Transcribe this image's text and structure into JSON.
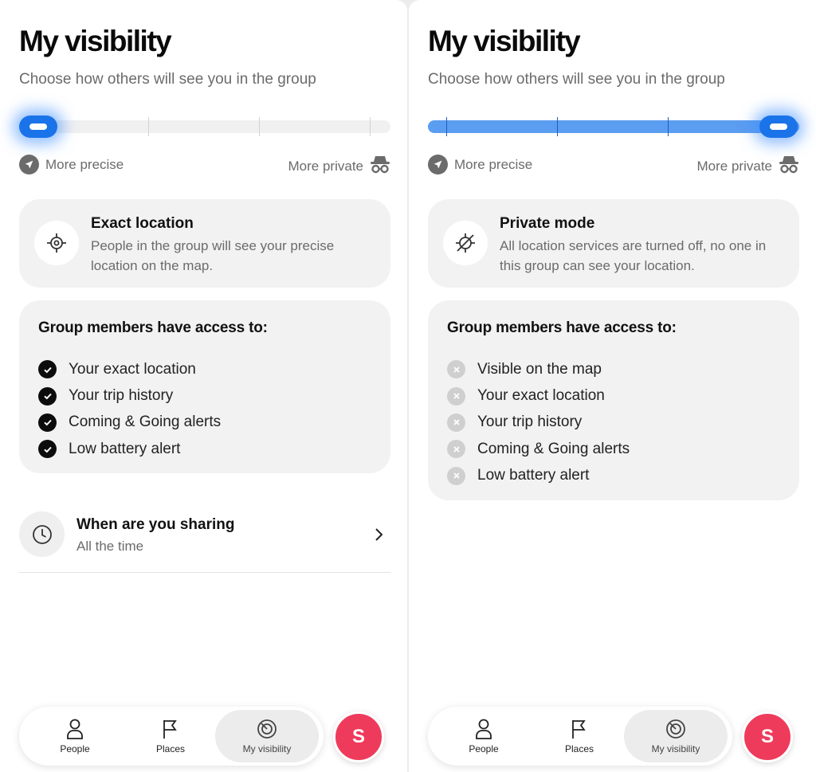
{
  "colors": {
    "accent": "#1a73e8",
    "track_fill": "#5b9df0",
    "avatar": "#ef3b5b",
    "check": "#0c0c0c",
    "cross": "#cfcfcf"
  },
  "screens": [
    {
      "title": "My visibility",
      "subtitle": "Choose how others will see you in the group",
      "slider": {
        "level": 0,
        "stops": 4
      },
      "scale": {
        "left_label": "More precise",
        "right_label": "More private",
        "left_icon": "navigation-arrow-icon",
        "right_icon": "incognito-icon"
      },
      "mode": {
        "icon": "crosshair-icon",
        "title": "Exact location",
        "description": "People in the group will see your precise location on the map."
      },
      "access": {
        "title": "Group members have access to:",
        "state": "enabled",
        "items": [
          {
            "label": "Your exact location"
          },
          {
            "label": "Your trip history"
          },
          {
            "label": "Coming & Going alerts"
          },
          {
            "label": "Low battery alert"
          }
        ]
      },
      "sharing": {
        "icon": "clock-icon",
        "title": "When are you sharing",
        "value": "All the time"
      },
      "tabs": [
        {
          "label": "People",
          "icon": "person-icon",
          "active": false
        },
        {
          "label": "Places",
          "icon": "flag-icon",
          "active": false
        },
        {
          "label": "My visibility",
          "icon": "visibility-icon",
          "active": true
        }
      ],
      "avatar_initial": "S"
    },
    {
      "title": "My visibility",
      "subtitle": "Choose how others will see you in the group",
      "slider": {
        "level": 1,
        "stops": 4
      },
      "scale": {
        "left_label": "More precise",
        "right_label": "More private",
        "left_icon": "navigation-arrow-icon",
        "right_icon": "incognito-icon"
      },
      "mode": {
        "icon": "location-off-icon",
        "title": "Private mode",
        "description": "All location services are turned off, no one in this group can see your location."
      },
      "access": {
        "title": "Group members have access to:",
        "state": "disabled",
        "items": [
          {
            "label": "Visible on the map"
          },
          {
            "label": "Your exact location"
          },
          {
            "label": "Your trip history"
          },
          {
            "label": "Coming & Going alerts"
          },
          {
            "label": "Low battery alert"
          }
        ]
      },
      "tabs": [
        {
          "label": "People",
          "icon": "person-icon",
          "active": false
        },
        {
          "label": "Places",
          "icon": "flag-icon",
          "active": false
        },
        {
          "label": "My visibility",
          "icon": "visibility-icon",
          "active": true
        }
      ],
      "avatar_initial": "S"
    }
  ]
}
